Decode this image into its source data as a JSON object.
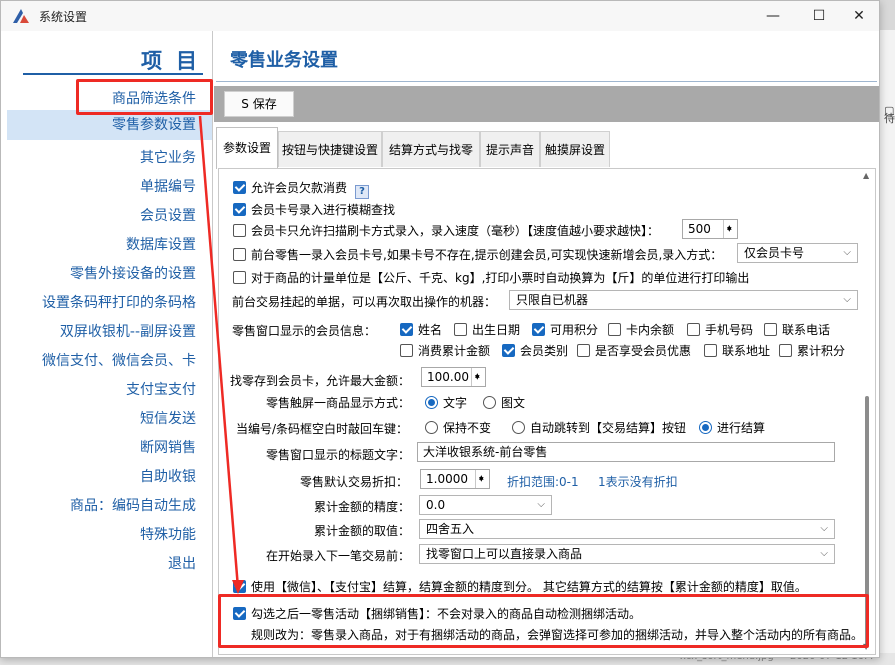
{
  "window": {
    "title": "系统设置"
  },
  "nav": {
    "title": "项目",
    "items": [
      "商品筛选条件",
      "零售参数设置",
      "其它业务",
      "单据编号",
      "会员设置",
      "数据库设置",
      "零售外接设备的设置",
      "设置条码秤打印的条码格",
      "双屏收银机--副屏设置",
      "微信支付、微信会员、卡",
      "支付宝支付",
      "短信发送",
      "断网销售",
      "自助收银",
      "商品：编码自动生成",
      "特殊功能",
      "退出"
    ],
    "active_index": 1
  },
  "main": {
    "title": "零售业务设置",
    "save_label": "S 保存",
    "tabs": [
      "参数设置",
      "按钮与快捷键设置",
      "结算方式与找零",
      "提示声音",
      "触摸屏设置"
    ],
    "active_tab": 0
  },
  "settings": {
    "allow_debt": {
      "label": "允许会员欠款消费",
      "checked": true
    },
    "fuzzy_card": {
      "label": "会员卡号录入进行模糊查找",
      "checked": true
    },
    "swipe_only": {
      "label": "会员卡只允许扫描刷卡方式录入，录入速度（毫秒）【速度值越小要求越快】：",
      "checked": false,
      "value": "500"
    },
    "create_member": {
      "label": "前台零售一录入会员卡号,如果卡号不存在,提示创建会员,可实现快速新增会员,录入方式：",
      "checked": false,
      "value": "仅会员卡号"
    },
    "weight_unit": {
      "label": "对于商品的计量单位是【公斤、千克、kg】,打印小票时自动换算为【斤】的单位进行打印输出",
      "checked": false
    },
    "hang_machine": {
      "label": "前台交易挂起的单据，可以再次取出操作的机器：",
      "value": "只限自已机器"
    },
    "member_info": {
      "label": "零售窗口显示的会员信息：",
      "options": [
        {
          "label": "姓名",
          "checked": true
        },
        {
          "label": "出生日期",
          "checked": false
        },
        {
          "label": "可用积分",
          "checked": true
        },
        {
          "label": "卡内余额",
          "checked": false
        },
        {
          "label": "手机号码",
          "checked": false
        },
        {
          "label": "联系电话",
          "checked": false
        },
        {
          "label": "消费累计金额",
          "checked": false
        },
        {
          "label": "会员类别",
          "checked": true
        },
        {
          "label": "是否享受会员优惠",
          "checked": false
        },
        {
          "label": "联系地址",
          "checked": false
        },
        {
          "label": "累计积分",
          "checked": false
        }
      ]
    },
    "change_max": {
      "label": "找零存到会员卡，允许最大金额：",
      "value": "100.00"
    },
    "touch_display": {
      "label": "零售触屏一商品显示方式：",
      "options": [
        "文字",
        "图文"
      ],
      "selected": 0
    },
    "enter_key": {
      "label": "当编号/条码框空白时敲回车键：",
      "options": [
        "保持不变",
        "自动跳转到【交易结算】按钮",
        "进行结算"
      ],
      "selected": 2
    },
    "window_title": {
      "label": "零售窗口显示的标题文字：",
      "value": "大洋收银系统-前台零售"
    },
    "discount": {
      "label": "零售默认交易折扣：",
      "value": "1.0000",
      "range": "折扣范围:0-1",
      "note": "1表示没有折扣"
    },
    "precision": {
      "label": "累计金额的精度：",
      "value": "0.0"
    },
    "rounding": {
      "label": "累计金额的取值：",
      "value": "四舍五入"
    },
    "before_next": {
      "label": "在开始录入下一笔交易前：",
      "value": "找零窗口上可以直接录入商品"
    },
    "wechat_alipay": {
      "label": "使用【微信】、【支付宝】结算，结算金额的精度到分。 其它结算方式的结算按【累计金额的精度】取值。",
      "checked": true
    },
    "bundle": {
      "label": "勾选之后一零售活动【捆绑销售】：不会对录入的商品自动检测捆绑活动。",
      "rule": "规则改为：零售录入商品，对于有捆绑活动的商品，会弹窗选择可参加的捆绑活动，并导入整个活动内的所有商品。",
      "checked": true
    }
  },
  "background": {
    "bottom_text": "xcx_sort_menu.jpg",
    "bottom_date": "2020-07-12 16:4"
  },
  "colors": {
    "accent": "#1f5fa6",
    "highlight": "#ee2a24",
    "checked": "#1769c1"
  }
}
